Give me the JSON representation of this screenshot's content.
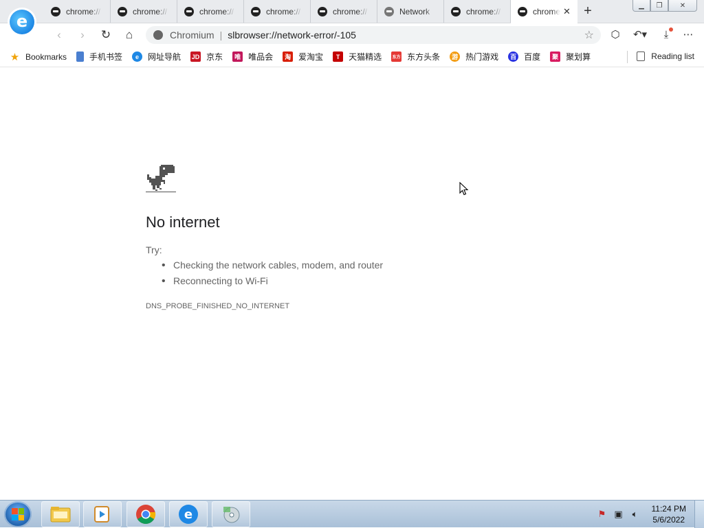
{
  "tabs": [
    {
      "label": "chrome://",
      "active": false,
      "icon": "browser-icon"
    },
    {
      "label": "chrome://",
      "active": false,
      "icon": "browser-icon"
    },
    {
      "label": "chrome://",
      "active": false,
      "icon": "browser-icon"
    },
    {
      "label": "chrome://",
      "active": false,
      "icon": "browser-icon"
    },
    {
      "label": "chrome://",
      "active": false,
      "icon": "browser-icon"
    },
    {
      "label": "Network",
      "active": false,
      "icon": "browser-icon"
    },
    {
      "label": "chrome://",
      "active": false,
      "icon": "browser-icon"
    },
    {
      "label": "chrome",
      "active": true,
      "icon": "browser-icon"
    }
  ],
  "omnibox": {
    "site_name": "Chromium",
    "url": "slbrowser://network-error/-105"
  },
  "bookmarks": [
    {
      "label": "Bookmarks",
      "icon": "star-icon",
      "color": "#f0a30a"
    },
    {
      "label": "手机书签",
      "icon": "phone-bookmark-icon",
      "color": "#4a7fd0"
    },
    {
      "label": "网址导航",
      "icon": "nav-icon",
      "color": "#1e88e5"
    },
    {
      "label": "京东",
      "icon": "jd-icon",
      "color": "#c91623",
      "glyph": "JD"
    },
    {
      "label": "唯品会",
      "icon": "vip-icon",
      "color": "#c2185b",
      "glyph": "唯"
    },
    {
      "label": "爱淘宝",
      "icon": "taobao-icon",
      "color": "#d81e06",
      "glyph": "淘"
    },
    {
      "label": "天猫精选",
      "icon": "tmall-icon",
      "color": "#c40000",
      "glyph": "T"
    },
    {
      "label": "东方头条",
      "icon": "toutiao-icon",
      "color": "#e53935",
      "glyph": "东方"
    },
    {
      "label": "热门游戏",
      "icon": "games-icon",
      "color": "#f39c12",
      "glyph": "游"
    },
    {
      "label": "百度",
      "icon": "baidu-icon",
      "color": "#2932e1",
      "glyph": "百"
    },
    {
      "label": "聚划算",
      "icon": "juhuasuan-icon",
      "color": "#d81b60",
      "glyph": "聚"
    }
  ],
  "reading_list": "Reading list",
  "error": {
    "title": "No internet",
    "try_label": "Try:",
    "suggestions": [
      "Checking the network cables, modem, and router",
      "Reconnecting to Wi-Fi"
    ],
    "code": "DNS_PROBE_FINISHED_NO_INTERNET"
  },
  "taskbar": {
    "apps": [
      "explorer-icon",
      "media-player-icon",
      "chrome-icon",
      "browser-icon",
      "media-center-icon"
    ],
    "time": "11:24 PM",
    "date": "5/6/2022"
  },
  "colors": {
    "accent": "#1e88e5",
    "text_dark": "#202124",
    "text_muted": "#646464"
  }
}
